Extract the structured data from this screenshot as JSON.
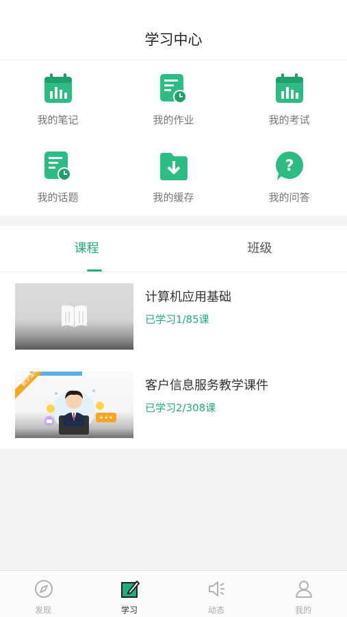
{
  "header": {
    "title": "学习中心"
  },
  "grid": {
    "items": [
      {
        "label": "我的笔记",
        "icon": "calendar-chart-icon"
      },
      {
        "label": "我的作业",
        "icon": "document-clock-icon"
      },
      {
        "label": "我的考试",
        "icon": "calendar-chart-icon"
      },
      {
        "label": "我的话题",
        "icon": "document-clock-icon"
      },
      {
        "label": "我的缓存",
        "icon": "folder-download-icon"
      },
      {
        "label": "我的问答",
        "icon": "question-bubble-icon"
      }
    ]
  },
  "tabs": [
    {
      "label": "课程",
      "active": true
    },
    {
      "label": "班级",
      "active": false
    }
  ],
  "courses": [
    {
      "title": "计算机应用基础",
      "progress": "已学习1/85课",
      "thumb_badge": ""
    },
    {
      "title": "客户信息服务教学课件",
      "progress": "已学习2/308课",
      "thumb_badge": "教学课件"
    }
  ],
  "bottom_nav": [
    {
      "label": "发现",
      "icon": "compass-icon",
      "active": false
    },
    {
      "label": "学习",
      "icon": "notebook-pen-icon",
      "active": true
    },
    {
      "label": "动态",
      "icon": "speaker-icon",
      "active": false
    },
    {
      "label": "我的",
      "icon": "user-icon",
      "active": false
    }
  ],
  "colors": {
    "accent": "#1fae7a",
    "icon_green": "#2dbd82"
  }
}
